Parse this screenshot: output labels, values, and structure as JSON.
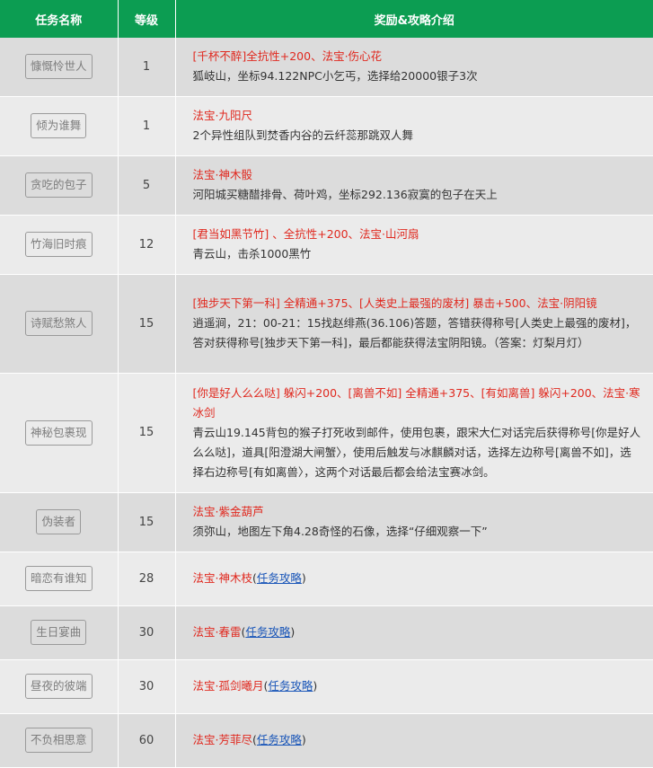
{
  "header": {
    "name_col": "任务名称",
    "level_col": "等级",
    "reward_col": "奖励&攻略介绍"
  },
  "rows": [
    {
      "name": "慷慨怜世人",
      "level": "1",
      "reward": "[千杯不醉]全抗性+200、法宝·伤心花",
      "desc": "狐岐山，坐标94.122NPC小乞丐，选择给20000银子3次"
    },
    {
      "name": "倾为谁舞",
      "level": "1",
      "reward": "法宝·九阳尺",
      "desc": "2个异性组队到焚香内谷的云纤蕊那跳双人舞"
    },
    {
      "name": "贪吃的包子",
      "level": "5",
      "reward": "法宝·神木骰",
      "desc": "河阳城买糖醋排骨、荷叶鸡，坐标292.136寂寞的包子在天上"
    },
    {
      "name": "竹海旧时痕",
      "level": "12",
      "reward": "[君当如黑节竹] 、全抗性+200、法宝·山河扇",
      "desc": "青云山，击杀1000黑竹"
    },
    {
      "name": "诗赋愁煞人",
      "level": "15",
      "reward": "[独步天下第一科] 全精通+375、[人类史上最强的废材] 暴击+500、法宝·阴阳镜",
      "desc": "逍遥涧，21：00-21：15找赵绯燕(36.106)答题，答错获得称号[人类史上最强的废材]，答对获得称号[独步天下第一科]，最后都能获得法宝阴阳镜。（答案：灯梨月灯）"
    },
    {
      "name": "神秘包裹现",
      "level": "15",
      "reward": "[你是好人么么哒] 躲闪+200、[离兽不如] 全精通+375、[有如离兽] 躲闪+200、法宝·寒冰剑",
      "desc": "青云山19.145背包的猴子打死收到邮件，使用包裹，跟宋大仁对话完后获得称号[你是好人么么哒]，道具[阳澄湖大闸蟹〉，使用后触发与冰麒麟对话，选择左边称号[离兽不如]，选择右边称号[有如离兽〉，这两个对话最后都会给法宝赛冰剑。"
    },
    {
      "name": "伪装者",
      "level": "15",
      "reward": "法宝·紫金葫芦",
      "desc": "须弥山，地图左下角4.28奇怪的石像，选择“仔细观察一下”"
    },
    {
      "name": "暗恋有谁知",
      "level": "28",
      "reward": "法宝·神木枝",
      "link": "任务攻略"
    },
    {
      "name": "生日宴曲",
      "level": "30",
      "reward": "法宝·春雷",
      "link": "任务攻略"
    },
    {
      "name": "昼夜的彼端",
      "level": "30",
      "reward": "法宝·孤剑曦月",
      "link": "任务攻略"
    },
    {
      "name": "不负相思意",
      "level": "60",
      "reward": "法宝·芳菲尽",
      "link": "任务攻略"
    }
  ]
}
